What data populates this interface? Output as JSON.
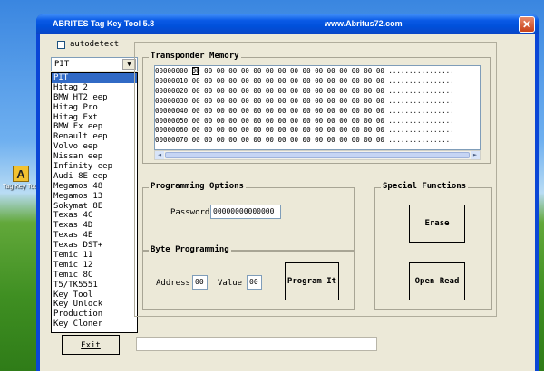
{
  "desktop": {
    "icon_label": "Tag Key Tool",
    "icon_glyph": "A"
  },
  "window": {
    "title": "ABRITES Tag Key Tool 5.8",
    "url": "www.Abritus72.com",
    "close_glyph": "✕"
  },
  "autodetect": {
    "label": "autodetect",
    "checked": false
  },
  "transponder_select": {
    "value": "PIT",
    "arrow_glyph": "▼",
    "options": [
      "PIT",
      "Hitag 2",
      "BMW HT2 eep",
      "Hitag Pro",
      "Hitag Ext",
      "BMW Fx eep",
      "Renault eep",
      "Volvo eep",
      "Nissan eep",
      "Infinity eep",
      "Audi 8E eep",
      "Megamos 48",
      "Megamos 13",
      "Sokymat 8E",
      "Texas 4C",
      "Texas 4D",
      "Texas 4E",
      "Texas DST+",
      "Temic 11",
      "Temic 12",
      "Temic 8C",
      "T5/TK5551",
      "Key Tool",
      "Key Unlock",
      "Production",
      "Key Cloner"
    ]
  },
  "transponder_memory": {
    "title": "Transponder Memory",
    "rows": [
      "00000000 00 00 00 00 00 00 00 00 00 00 00 00 00 00 00 00 ................",
      "00000010 00 00 00 00 00 00 00 00 00 00 00 00 00 00 00 00 ................",
      "00000020 00 00 00 00 00 00 00 00 00 00 00 00 00 00 00 00 ................",
      "00000030 00 00 00 00 00 00 00 00 00 00 00 00 00 00 00 00 ................",
      "00000040 00 00 00 00 00 00 00 00 00 00 00 00 00 00 00 00 ................",
      "00000050 00 00 00 00 00 00 00 00 00 00 00 00 00 00 00 00 ................",
      "00000060 00 00 00 00 00 00 00 00 00 00 00 00 00 00 00 00 ................",
      "00000070 00 00 00 00 00 00 00 00 00 00 00 00 00 00 00 00 ................"
    ],
    "scroll_left_glyph": "◄",
    "scroll_right_glyph": "►"
  },
  "programming_options": {
    "title": "Programming Options",
    "password_label": "Password",
    "password_value": "00000000000000"
  },
  "byte_programming": {
    "title": "Byte Programming",
    "address_label": "Address",
    "address_value": "00",
    "value_label": "Value",
    "value_value": "00",
    "program_button": "Program It"
  },
  "special_functions": {
    "title": "Special Functions",
    "erase_button": "Erase",
    "open_read_button": "Open Read"
  },
  "exit_button": "Exit",
  "status_text": ""
}
